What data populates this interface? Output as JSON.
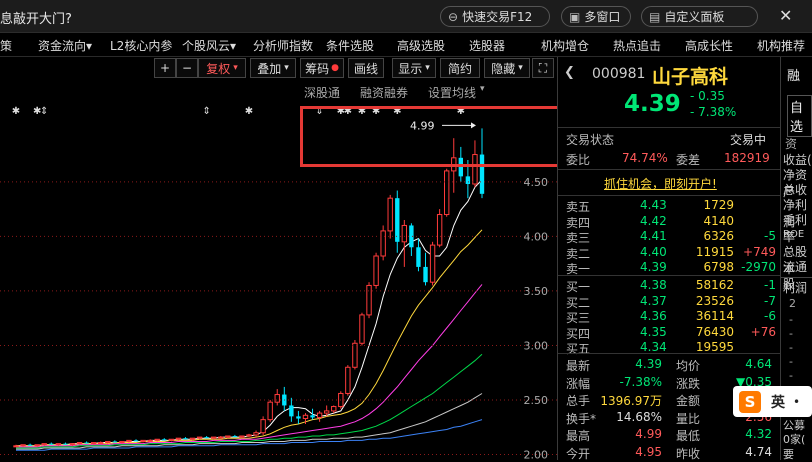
{
  "titlebar": {
    "title": "息敲开大门?",
    "quick_trade": "快速交易F12",
    "multi_window": "多窗口",
    "custom_panel": "自定义面板"
  },
  "menu": [
    "资金流向▾",
    "L2核心内参",
    "个股风云▾",
    "分析师指数",
    "条件选股",
    "高级选股",
    "选股器",
    "机构增仓",
    "热点追击",
    "高成长性",
    "机构推荐"
  ],
  "menu_left_fragment": "策",
  "toolbar": {
    "plus": "+",
    "minus": "−",
    "restore": "复权",
    "overlay": "叠加",
    "chips": "筹码",
    "line": "画线",
    "display": "显示",
    "simple": "简约",
    "hide": "隐藏",
    "expand": "⛶"
  },
  "subtool": {
    "sh_sz_tong": "深股通",
    "margin": "融资融券",
    "set_ma": "设置均线"
  },
  "colors": {
    "up": "#ff3b3b",
    "down": "#00e5ff",
    "yellow": "#ffd93d",
    "green": "#00d84a",
    "gray": "#c8c8c8",
    "highlight": "#e53935"
  },
  "chart_data": {
    "type": "candlestick",
    "y_ticks": [
      4.5,
      4.0,
      3.5,
      3.0,
      2.5,
      2.0
    ],
    "ylim": [
      1.95,
      5.25
    ],
    "annotation": "4.99",
    "candles": [
      [
        2.08,
        2.09,
        2.07,
        2.08
      ],
      [
        2.08,
        2.09,
        2.07,
        2.09
      ],
      [
        2.09,
        2.1,
        2.08,
        2.08
      ],
      [
        2.08,
        2.09,
        2.07,
        2.09
      ],
      [
        2.09,
        2.1,
        2.08,
        2.1
      ],
      [
        2.1,
        2.11,
        2.09,
        2.09
      ],
      [
        2.09,
        2.1,
        2.08,
        2.1
      ],
      [
        2.1,
        2.11,
        2.09,
        2.09
      ],
      [
        2.09,
        2.1,
        2.08,
        2.1
      ],
      [
        2.1,
        2.11,
        2.09,
        2.11
      ],
      [
        2.11,
        2.12,
        2.1,
        2.1
      ],
      [
        2.1,
        2.11,
        2.09,
        2.11
      ],
      [
        2.11,
        2.12,
        2.1,
        2.11
      ],
      [
        2.11,
        2.12,
        2.1,
        2.12
      ],
      [
        2.12,
        2.13,
        2.11,
        2.11
      ],
      [
        2.11,
        2.12,
        2.1,
        2.12
      ],
      [
        2.12,
        2.13,
        2.11,
        2.13
      ],
      [
        2.13,
        2.14,
        2.12,
        2.12
      ],
      [
        2.12,
        2.13,
        2.11,
        2.13
      ],
      [
        2.13,
        2.14,
        2.12,
        2.13
      ],
      [
        2.13,
        2.14,
        2.12,
        2.14
      ],
      [
        2.14,
        2.15,
        2.13,
        2.13
      ],
      [
        2.13,
        2.14,
        2.12,
        2.14
      ],
      [
        2.14,
        2.15,
        2.13,
        2.15
      ],
      [
        2.15,
        2.16,
        2.14,
        2.14
      ],
      [
        2.14,
        2.15,
        2.13,
        2.15
      ],
      [
        2.15,
        2.16,
        2.14,
        2.16
      ],
      [
        2.16,
        2.17,
        2.15,
        2.15
      ],
      [
        2.15,
        2.16,
        2.14,
        2.16
      ],
      [
        2.16,
        2.17,
        2.15,
        2.16
      ],
      [
        2.16,
        2.17,
        2.15,
        2.17
      ],
      [
        2.17,
        2.18,
        2.16,
        2.16
      ],
      [
        2.16,
        2.17,
        2.15,
        2.17
      ],
      [
        2.17,
        2.19,
        2.16,
        2.18
      ],
      [
        2.18,
        2.22,
        2.16,
        2.2
      ],
      [
        2.2,
        2.35,
        2.18,
        2.32
      ],
      [
        2.32,
        2.5,
        2.3,
        2.48
      ],
      [
        2.48,
        2.6,
        2.45,
        2.55
      ],
      [
        2.55,
        2.62,
        2.4,
        2.45
      ],
      [
        2.45,
        2.52,
        2.3,
        2.35
      ],
      [
        2.35,
        2.4,
        2.28,
        2.33
      ],
      [
        2.33,
        2.38,
        2.28,
        2.36
      ],
      [
        2.36,
        2.42,
        2.32,
        2.34
      ],
      [
        2.34,
        2.4,
        2.3,
        2.38
      ],
      [
        2.38,
        2.45,
        2.35,
        2.4
      ],
      [
        2.4,
        2.45,
        2.38,
        2.44
      ],
      [
        2.44,
        2.58,
        2.42,
        2.56
      ],
      [
        2.56,
        2.82,
        2.54,
        2.8
      ],
      [
        2.8,
        3.05,
        2.78,
        3.02
      ],
      [
        3.02,
        3.3,
        3.0,
        3.28
      ],
      [
        3.28,
        3.58,
        3.25,
        3.55
      ],
      [
        3.55,
        3.85,
        3.52,
        3.82
      ],
      [
        3.82,
        4.1,
        3.78,
        4.05
      ],
      [
        4.05,
        4.38,
        3.98,
        4.35
      ],
      [
        4.35,
        4.42,
        3.85,
        3.95
      ],
      [
        3.95,
        4.15,
        3.72,
        4.1
      ],
      [
        4.1,
        4.12,
        3.82,
        3.9
      ],
      [
        3.9,
        3.98,
        3.68,
        3.72
      ],
      [
        3.72,
        3.85,
        3.55,
        3.58
      ],
      [
        3.58,
        3.95,
        3.55,
        3.92
      ],
      [
        3.92,
        4.25,
        3.9,
        4.2
      ],
      [
        4.2,
        4.62,
        4.18,
        4.6
      ],
      [
        4.6,
        4.9,
        4.4,
        4.72
      ],
      [
        4.72,
        4.82,
        4.5,
        4.55
      ],
      [
        4.55,
        4.7,
        4.35,
        4.48
      ],
      [
        4.48,
        4.88,
        4.45,
        4.75
      ],
      [
        4.75,
        4.99,
        4.35,
        4.39
      ]
    ],
    "ma_series": [
      {
        "color": "#ffffff",
        "values": [
          2.08,
          2.08,
          2.08,
          2.08,
          2.09,
          2.09,
          2.09,
          2.09,
          2.1,
          2.1,
          2.1,
          2.1,
          2.11,
          2.11,
          2.11,
          2.11,
          2.12,
          2.12,
          2.12,
          2.13,
          2.13,
          2.13,
          2.13,
          2.14,
          2.14,
          2.14,
          2.15,
          2.15,
          2.15,
          2.16,
          2.16,
          2.16,
          2.16,
          2.17,
          2.18,
          2.21,
          2.27,
          2.35,
          2.4,
          2.43,
          2.43,
          2.42,
          2.37,
          2.35,
          2.36,
          2.38,
          2.4,
          2.5,
          2.62,
          2.8,
          3.0,
          3.2,
          3.45,
          3.65,
          3.8,
          3.9,
          3.95,
          3.98,
          3.87,
          3.82,
          3.82,
          3.9,
          4.1,
          4.24,
          4.32,
          4.45,
          4.52
        ]
      },
      {
        "color": "#ffd93d",
        "values": [
          2.08,
          2.08,
          2.08,
          2.08,
          2.09,
          2.09,
          2.09,
          2.09,
          2.09,
          2.1,
          2.1,
          2.1,
          2.1,
          2.1,
          2.11,
          2.11,
          2.11,
          2.11,
          2.12,
          2.12,
          2.12,
          2.12,
          2.13,
          2.13,
          2.13,
          2.13,
          2.14,
          2.14,
          2.14,
          2.14,
          2.15,
          2.15,
          2.15,
          2.15,
          2.16,
          2.17,
          2.19,
          2.22,
          2.25,
          2.27,
          2.28,
          2.3,
          2.32,
          2.33,
          2.35,
          2.36,
          2.37,
          2.39,
          2.42,
          2.47,
          2.55,
          2.65,
          2.77,
          2.9,
          3.03,
          3.15,
          3.27,
          3.37,
          3.45,
          3.53,
          3.62,
          3.7,
          3.78,
          3.86,
          3.92,
          3.99,
          4.06
        ]
      },
      {
        "color": "#ff3ee6",
        "values": [
          2.07,
          2.07,
          2.07,
          2.07,
          2.08,
          2.08,
          2.08,
          2.08,
          2.08,
          2.09,
          2.09,
          2.09,
          2.09,
          2.09,
          2.1,
          2.1,
          2.1,
          2.1,
          2.1,
          2.11,
          2.11,
          2.11,
          2.11,
          2.12,
          2.12,
          2.12,
          2.12,
          2.12,
          2.13,
          2.13,
          2.13,
          2.13,
          2.14,
          2.14,
          2.14,
          2.15,
          2.16,
          2.17,
          2.18,
          2.19,
          2.2,
          2.21,
          2.22,
          2.23,
          2.24,
          2.25,
          2.26,
          2.28,
          2.3,
          2.33,
          2.37,
          2.42,
          2.48,
          2.55,
          2.62,
          2.7,
          2.78,
          2.86,
          2.93,
          3.0,
          3.08,
          3.16,
          3.24,
          3.32,
          3.4,
          3.48,
          3.56
        ]
      },
      {
        "color": "#00d84a",
        "values": [
          2.06,
          2.06,
          2.06,
          2.06,
          2.07,
          2.07,
          2.07,
          2.07,
          2.07,
          2.08,
          2.08,
          2.08,
          2.08,
          2.08,
          2.09,
          2.09,
          2.09,
          2.09,
          2.09,
          2.1,
          2.1,
          2.1,
          2.1,
          2.1,
          2.11,
          2.11,
          2.11,
          2.11,
          2.11,
          2.12,
          2.12,
          2.12,
          2.12,
          2.12,
          2.13,
          2.13,
          2.14,
          2.14,
          2.15,
          2.15,
          2.16,
          2.16,
          2.17,
          2.17,
          2.18,
          2.18,
          2.19,
          2.2,
          2.21,
          2.22,
          2.24,
          2.26,
          2.29,
          2.32,
          2.36,
          2.4,
          2.44,
          2.48,
          2.52,
          2.56,
          2.61,
          2.66,
          2.71,
          2.76,
          2.81,
          2.86,
          2.92
        ]
      },
      {
        "color": "#c8c8c8",
        "values": [
          2.05,
          2.05,
          2.05,
          2.05,
          2.06,
          2.06,
          2.06,
          2.06,
          2.06,
          2.06,
          2.07,
          2.07,
          2.07,
          2.07,
          2.07,
          2.08,
          2.08,
          2.08,
          2.08,
          2.08,
          2.08,
          2.09,
          2.09,
          2.09,
          2.09,
          2.09,
          2.1,
          2.1,
          2.1,
          2.1,
          2.1,
          2.1,
          2.11,
          2.11,
          2.11,
          2.11,
          2.12,
          2.12,
          2.12,
          2.13,
          2.13,
          2.13,
          2.14,
          2.14,
          2.14,
          2.15,
          2.15,
          2.15,
          2.16,
          2.16,
          2.17,
          2.18,
          2.19,
          2.2,
          2.22,
          2.24,
          2.26,
          2.28,
          2.3,
          2.33,
          2.36,
          2.39,
          2.42,
          2.45,
          2.48,
          2.52,
          2.56
        ]
      },
      {
        "color": "#3b82f6",
        "values": [
          2.04,
          2.04,
          2.04,
          2.04,
          2.04,
          2.05,
          2.05,
          2.05,
          2.05,
          2.05,
          2.05,
          2.06,
          2.06,
          2.06,
          2.06,
          2.06,
          2.06,
          2.07,
          2.07,
          2.07,
          2.07,
          2.07,
          2.07,
          2.08,
          2.08,
          2.08,
          2.08,
          2.08,
          2.08,
          2.09,
          2.09,
          2.09,
          2.09,
          2.09,
          2.09,
          2.1,
          2.1,
          2.1,
          2.1,
          2.11,
          2.11,
          2.11,
          2.11,
          2.12,
          2.12,
          2.12,
          2.12,
          2.13,
          2.13,
          2.13,
          2.14,
          2.14,
          2.15,
          2.15,
          2.16,
          2.17,
          2.18,
          2.19,
          2.2,
          2.21,
          2.22,
          2.23,
          2.25,
          2.26,
          2.28,
          2.3,
          2.32
        ]
      }
    ]
  },
  "quote": {
    "code": "000981",
    "name": "山子高科",
    "price": "4.39",
    "change": "- 0.35",
    "pct": "- 7.38%",
    "trade_status_label": "交易状态",
    "trade_status": "交易中",
    "wei_bi_label": "委比",
    "wei_bi": "74.74%",
    "wei_cha_label": "委差",
    "wei_cha": "182919",
    "promo": "抓住机会，即刻开户!",
    "sells": [
      {
        "label": "卖五",
        "price": "4.43",
        "vol": "1729",
        "chg": ""
      },
      {
        "label": "卖四",
        "price": "4.42",
        "vol": "4140",
        "chg": ""
      },
      {
        "label": "卖三",
        "price": "4.41",
        "vol": "6326",
        "chg": "-5"
      },
      {
        "label": "卖二",
        "price": "4.40",
        "vol": "11915",
        "chg": "+749"
      },
      {
        "label": "卖一",
        "price": "4.39",
        "vol": "6798",
        "chg": "-2970"
      }
    ],
    "buys": [
      {
        "label": "买一",
        "price": "4.38",
        "vol": "58162",
        "chg": "-1"
      },
      {
        "label": "买二",
        "price": "4.37",
        "vol": "23526",
        "chg": "-7"
      },
      {
        "label": "买三",
        "price": "4.36",
        "vol": "36114",
        "chg": "-6"
      },
      {
        "label": "买四",
        "price": "4.35",
        "vol": "76430",
        "chg": "+76"
      },
      {
        "label": "买五",
        "price": "4.34",
        "vol": "19595",
        "chg": ""
      }
    ],
    "stats": {
      "latest_label": "最新",
      "latest": "4.39",
      "avg_label": "均价",
      "avg": "4.64",
      "change_pct_label": "涨幅",
      "change_pct": "-7.38%",
      "change_label": "涨跌",
      "change_val": "▼0.35",
      "total_label": "总手",
      "total": "1396.97万",
      "amount_label": "金额",
      "amount": "6",
      "turnover_label": "换手*",
      "turnover": "14.68%",
      "vol_ratio_label": "量比",
      "vol_ratio": "2.56",
      "high_label": "最高",
      "high": "4.99",
      "low_label": "最低",
      "low": "4.32",
      "open_label": "今开",
      "open": "4.95",
      "prev_label": "昨收",
      "prev": "4.74"
    }
  },
  "rstrip": {
    "rong": "融",
    "zixuan": "自选",
    "zi": "资",
    "items": [
      "收益(",
      "净资产",
      "总收",
      "净利润",
      "毛利率"
    ],
    "roe": "ROE",
    "zong_gu": "总股本",
    "liutong": "流通股",
    "profit": "利润",
    "nums": [
      "2",
      "-",
      "-",
      "-",
      "-",
      "-",
      "-",
      "-",
      "-"
    ],
    "gonggao": "公募",
    "zero_jia": "0家(",
    "yao": "要"
  },
  "ime": {
    "mode": "英"
  }
}
